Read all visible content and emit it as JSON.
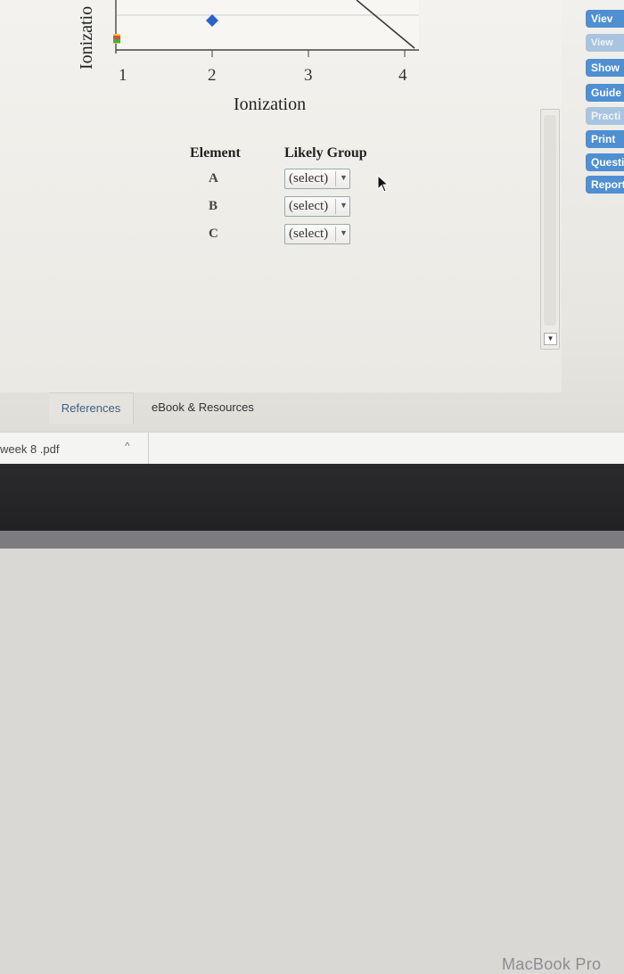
{
  "graph": {
    "y_axis_title": "Ionizatio",
    "x_axis_title": "Ionization",
    "tick_labels": [
      "1",
      "2",
      "3",
      "4"
    ]
  },
  "table": {
    "col_element": "Element",
    "col_group": "Likely Group",
    "rows": [
      {
        "element": "A",
        "selected": "(select)"
      },
      {
        "element": "B",
        "selected": "(select)"
      },
      {
        "element": "C",
        "selected": "(select)"
      }
    ]
  },
  "sidebar": {
    "buttons": [
      {
        "label": "Viev"
      },
      {
        "label": "View"
      },
      {
        "label": "Show"
      },
      {
        "label": "Guide"
      },
      {
        "label": "Practi"
      },
      {
        "label": "Print"
      },
      {
        "label": "Questi"
      },
      {
        "label": "Report"
      }
    ]
  },
  "tabs": {
    "references": "References",
    "ebook": "eBook & Resources"
  },
  "downloads": {
    "file_name": "week 8 .pdf"
  },
  "device": {
    "label": "MacBook Pro"
  },
  "colors": {
    "accent": "#4f8fd2",
    "marker": "#2a62c8"
  }
}
